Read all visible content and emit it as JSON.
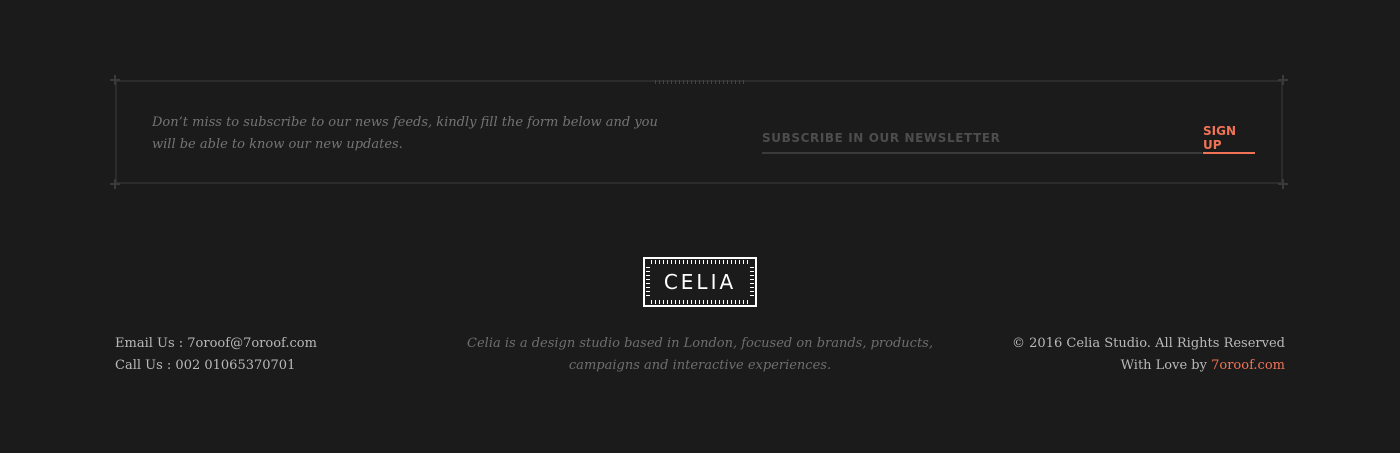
{
  "newsletter": {
    "description": "Don’t miss to subscribe to our news feeds, kindly fill the form below and you will be able to know our new updates.",
    "input_placeholder": "SUBSCRIBE IN OUR NEWSLETTER",
    "signup_label": "SIGN UP"
  },
  "logo": {
    "text": "CELIA"
  },
  "contact": {
    "email_line": "Email Us : 7oroof@7oroof.com",
    "phone_line": "Call Us : 002 01065370701"
  },
  "about": {
    "text": "Celia is a design studio based in London, focused on brands, products, campaigns and interactive experiences."
  },
  "copyright": {
    "line": "© 2016 Celia Studio. All Rights Reserved",
    "credit_prefix": "With Love by ",
    "credit_link": "7oroof.com"
  },
  "colors": {
    "background": "#1b1b1b",
    "accent": "#f07356",
    "border": "#2c2c2c",
    "text_light": "#b9b9b9",
    "text_muted": "#747474"
  }
}
